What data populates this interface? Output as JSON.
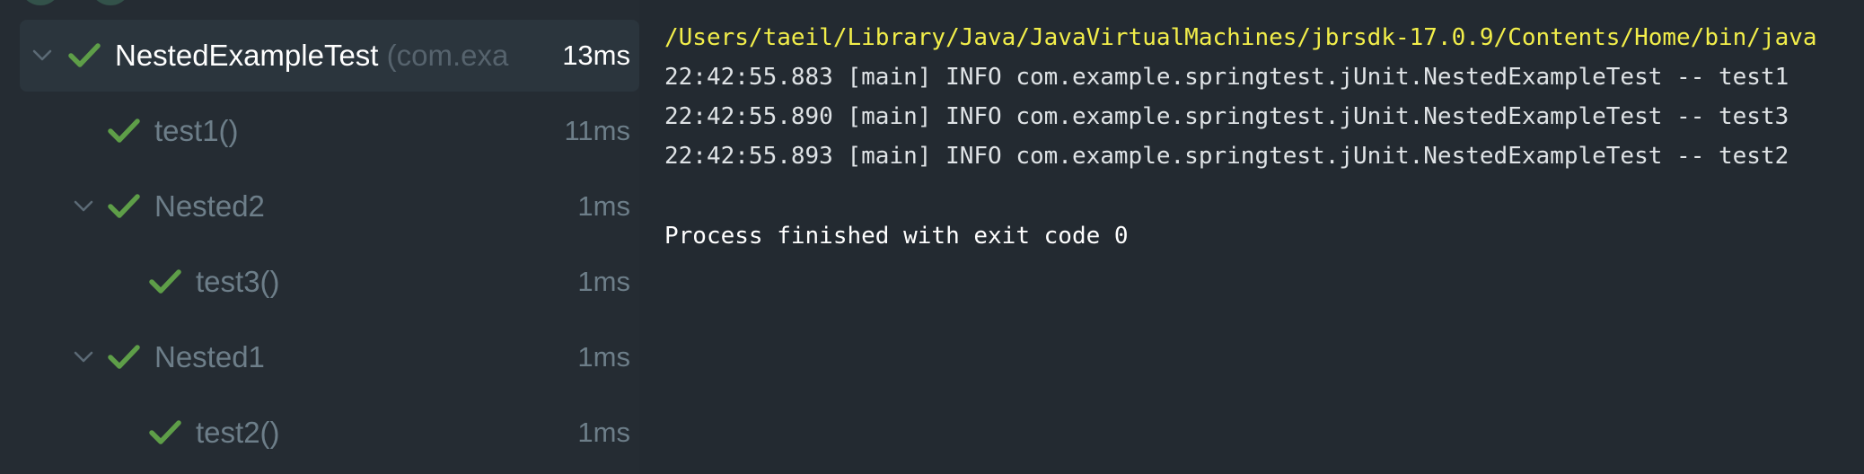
{
  "test_tree": {
    "root": {
      "name": "NestedExampleTest",
      "package": "(com.exa",
      "duration": "13ms",
      "status": "passed"
    },
    "items": [
      {
        "name": "test1()",
        "duration": "11ms",
        "status": "passed",
        "expandable": false
      },
      {
        "name": "Nested2",
        "duration": "1ms",
        "status": "passed",
        "expandable": true
      },
      {
        "name": "test3()",
        "duration": "1ms",
        "status": "passed",
        "expandable": false
      },
      {
        "name": "Nested1",
        "duration": "1ms",
        "status": "passed",
        "expandable": true
      },
      {
        "name": "test2()",
        "duration": "1ms",
        "status": "passed",
        "expandable": false
      }
    ]
  },
  "console": {
    "command": "/Users/taeil/Library/Java/JavaVirtualMachines/jbrsdk-17.0.9/Contents/Home/bin/java",
    "lines": [
      "22:42:55.883 [main] INFO com.example.springtest.jUnit.NestedExampleTest -- test1",
      "22:42:55.890 [main] INFO com.example.springtest.jUnit.NestedExampleTest -- test3",
      "22:42:55.893 [main] INFO com.example.springtest.jUnit.NestedExampleTest -- test2"
    ],
    "process_finished": "Process finished with exit code 0"
  },
  "colors": {
    "background": "#232a31",
    "tree_background": "#252c33",
    "selected_row": "#2b353d",
    "pass_green": "#5e9e48",
    "command_yellow": "#f2ee4a",
    "dim_text": "#6d7e89"
  },
  "icons": {
    "expand": "chevron-down-icon",
    "pass": "check-icon"
  }
}
